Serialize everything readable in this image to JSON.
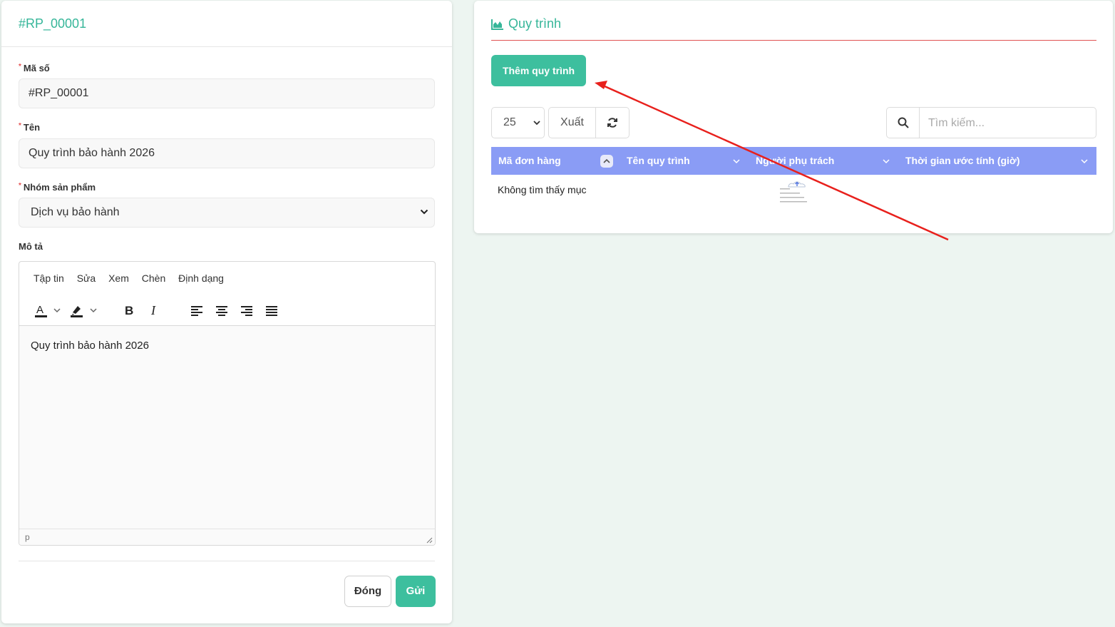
{
  "left_panel": {
    "title": "#RP_00001",
    "fields": {
      "code": {
        "label": "Mã số",
        "value": "#RP_00001"
      },
      "name": {
        "label": "Tên",
        "value": "Quy trình bảo hành 2026"
      },
      "group": {
        "label": "Nhóm sản phẩm",
        "value": "Dịch vụ bảo hành"
      },
      "description": {
        "label": "Mô tả"
      }
    },
    "editor": {
      "menu": [
        "Tập tin",
        "Sửa",
        "Xem",
        "Chèn",
        "Định dạng"
      ],
      "toolbar_icons": [
        "text-color-icon",
        "highlight-color-icon",
        "bold-icon",
        "italic-icon",
        "align-left-icon",
        "align-center-icon",
        "align-right-icon",
        "align-justify-icon"
      ],
      "content": "Quy trình bảo hành 2026",
      "status_path": "p"
    },
    "buttons": {
      "close": "Đóng",
      "submit": "Gửi"
    }
  },
  "right_panel": {
    "title": "Quy trình",
    "title_icon": "area-chart-icon",
    "add_button": "Thêm quy trình",
    "controls": {
      "page_size": "25",
      "export": "Xuất",
      "refresh_icon": "refresh-icon",
      "search_icon": "search-icon",
      "search_placeholder": "Tìm kiếm..."
    },
    "table": {
      "columns": [
        "Mã đơn hàng",
        "Tên quy trình",
        "Người phụ trách",
        "Thời gian ước tính (giờ)"
      ],
      "empty_text": "Không tìm thấy mục"
    }
  },
  "colors": {
    "accent": "#3dbf9e",
    "title": "#36b699",
    "table_header": "#8a9cf5",
    "divider_red": "#e05252",
    "annotation_arrow": "#e8201c",
    "page_bg": "#edf5f1"
  }
}
